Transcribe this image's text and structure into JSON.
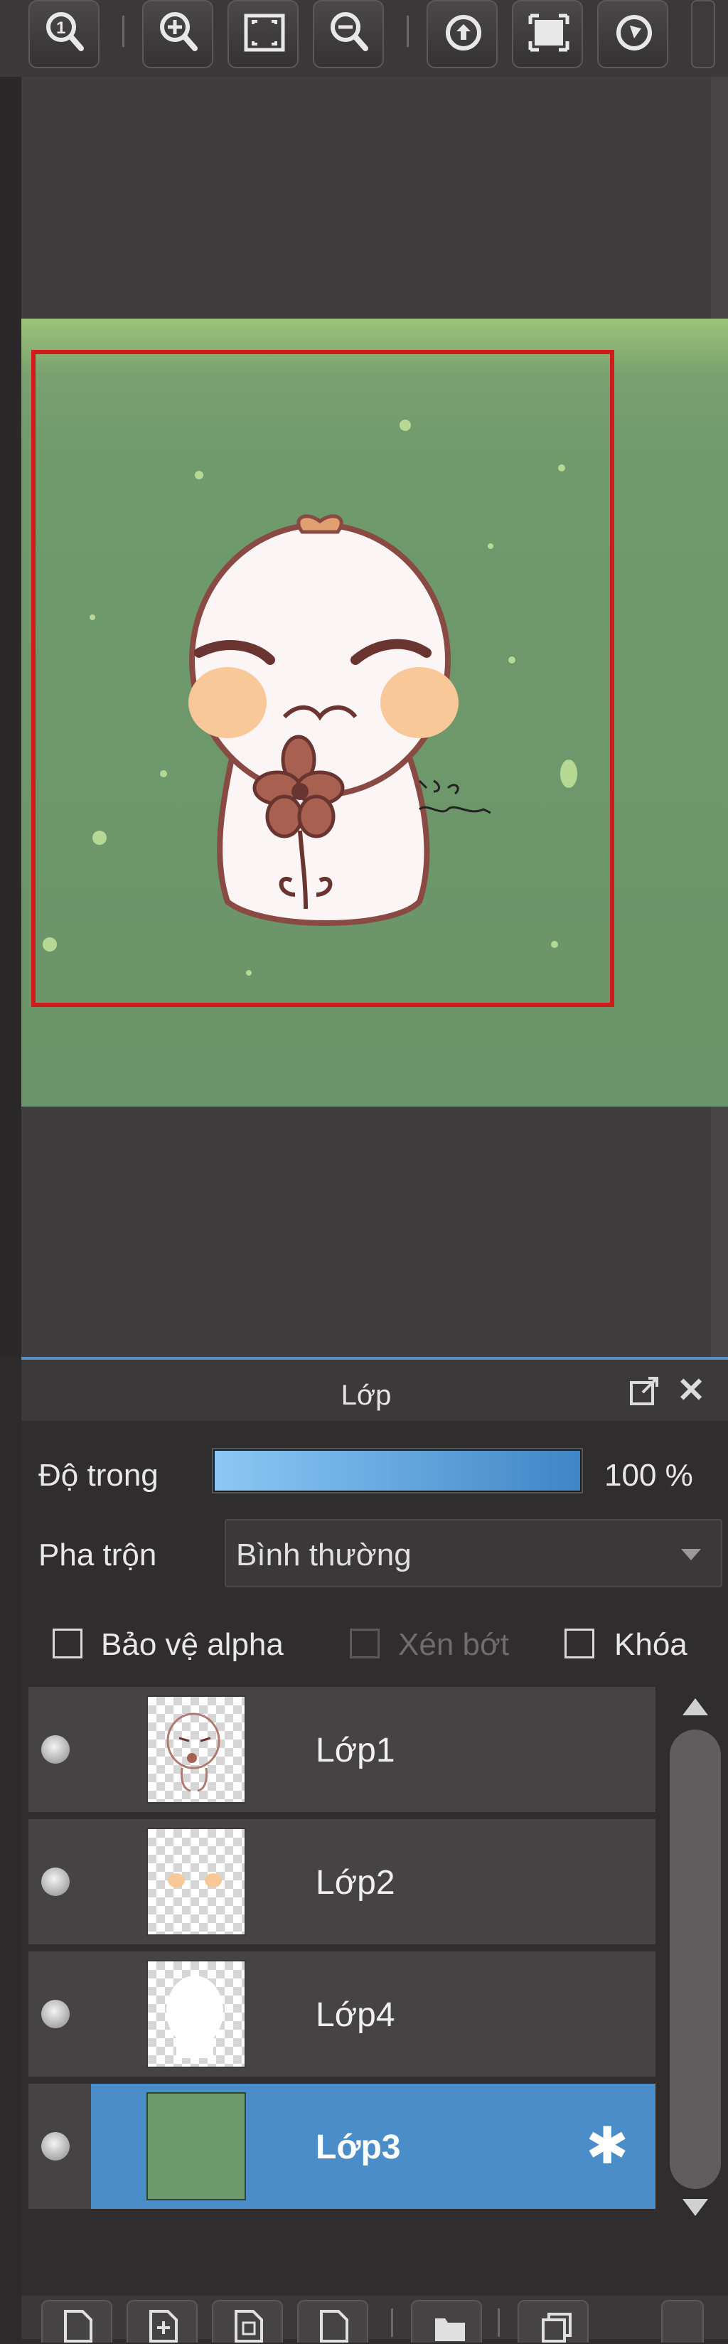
{
  "toolbar": {
    "buttons": [
      {
        "name": "zoom-actual-icon"
      },
      {
        "name": "zoom-in-icon"
      },
      {
        "name": "fit-screen-icon"
      },
      {
        "name": "zoom-out-icon"
      },
      {
        "name": "rotate-left-icon"
      },
      {
        "name": "fit-window-icon"
      },
      {
        "name": "rotate-right-icon"
      }
    ]
  },
  "panel": {
    "title": "Lớp",
    "opacity_label": "Độ trong",
    "opacity_value": "100 %",
    "opacity_percent": 100,
    "blend_label": "Pha trộn",
    "blend_value": "Bình thường",
    "checkboxes": [
      {
        "label": "Bảo vệ alpha",
        "checked": false,
        "enabled": true
      },
      {
        "label": "Xén bớt",
        "checked": false,
        "enabled": false
      },
      {
        "label": "Khóa",
        "checked": false,
        "enabled": true
      }
    ]
  },
  "layers": [
    {
      "name": "Lớp1",
      "visible": true,
      "selected": false
    },
    {
      "name": "Lớp2",
      "visible": true,
      "selected": false
    },
    {
      "name": "Lớp4",
      "visible": true,
      "selected": false
    },
    {
      "name": "Lớp3",
      "visible": true,
      "selected": true
    }
  ],
  "colors": {
    "accent": "#4a8dc9",
    "selection_border": "#d11a1a",
    "canvas_green": "#6b956a"
  },
  "bottom_bar": {
    "buttons": [
      "new-layer-icon",
      "add-layer-icon",
      "duplicate-layer-icon",
      "layer-file-icon",
      "folder-icon",
      "copy-icon"
    ]
  }
}
